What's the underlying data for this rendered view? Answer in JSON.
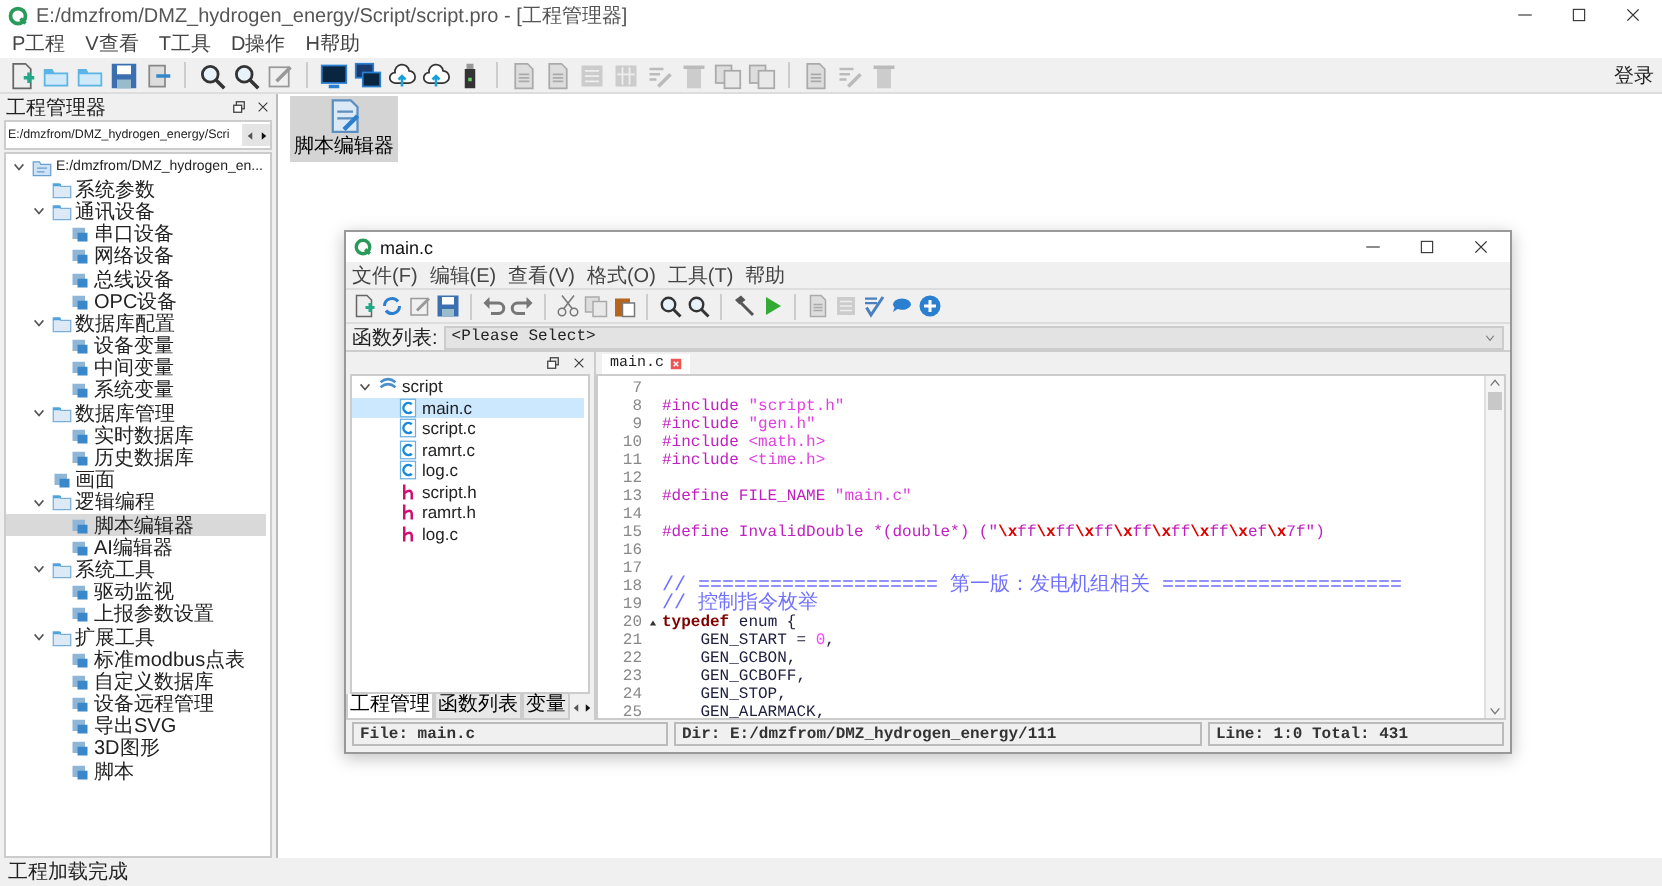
{
  "window": {
    "title": "E:/dmzfrom/DMZ_hydrogen_energy/Script/script.pro - [工程管理器]"
  },
  "menu": [
    "P工程",
    "V查看",
    "T工具",
    "D操作",
    "H帮助"
  ],
  "toolbar": {
    "login": "登录"
  },
  "project_panel": {
    "title": "工程管理器",
    "path": "E:/dmzfrom/DMZ_hydrogen_energy/Scri",
    "tree": [
      {
        "label": "E:/dmzfrom/DMZ_hydrogen_en...",
        "kind": "project",
        "expanded": true,
        "selected": false,
        "children": [
          {
            "label": "系统参数",
            "kind": "folder",
            "selected": false
          },
          {
            "label": "通讯设备",
            "kind": "folder",
            "expanded": true,
            "selected": false,
            "children": [
              {
                "label": "串口设备",
                "kind": "item",
                "selected": false
              },
              {
                "label": "网络设备",
                "kind": "item",
                "selected": false
              },
              {
                "label": "总线设备",
                "kind": "item",
                "selected": false
              },
              {
                "label": "OPC设备",
                "kind": "item",
                "selected": false
              }
            ]
          },
          {
            "label": "数据库配置",
            "kind": "folder",
            "expanded": true,
            "selected": false,
            "children": [
              {
                "label": "设备变量",
                "kind": "item",
                "selected": false
              },
              {
                "label": "中间变量",
                "kind": "item",
                "selected": false
              },
              {
                "label": "系统变量",
                "kind": "item",
                "selected": false
              }
            ]
          },
          {
            "label": "数据库管理",
            "kind": "folder",
            "expanded": true,
            "selected": false,
            "children": [
              {
                "label": "实时数据库",
                "kind": "item",
                "selected": false
              },
              {
                "label": "历史数据库",
                "kind": "item",
                "selected": false
              }
            ]
          },
          {
            "label": "画面",
            "kind": "item",
            "selected": false
          },
          {
            "label": "逻辑编程",
            "kind": "folder",
            "expanded": true,
            "selected": false,
            "children": [
              {
                "label": "脚本编辑器",
                "kind": "item",
                "selected": true
              },
              {
                "label": "AI编辑器",
                "kind": "item",
                "selected": false
              }
            ]
          },
          {
            "label": "系统工具",
            "kind": "folder",
            "expanded": true,
            "selected": false,
            "children": [
              {
                "label": "驱动监视",
                "kind": "item",
                "selected": false
              },
              {
                "label": "上报参数设置",
                "kind": "item",
                "selected": false
              }
            ]
          },
          {
            "label": "扩展工具",
            "kind": "folder",
            "expanded": true,
            "selected": false,
            "children": [
              {
                "label": "标准modbus点表",
                "kind": "item",
                "selected": false
              },
              {
                "label": "自定义数据库",
                "kind": "item",
                "selected": false
              },
              {
                "label": "设备远程管理",
                "kind": "item",
                "selected": false
              },
              {
                "label": "导出SVG",
                "kind": "item",
                "selected": false
              },
              {
                "label": "3D图形",
                "kind": "item",
                "selected": false
              },
              {
                "label": "脚本",
                "kind": "item",
                "selected": false
              }
            ]
          }
        ]
      }
    ]
  },
  "desktop_icons": [
    {
      "label": "脚本编辑器",
      "selected": true
    }
  ],
  "editor_window": {
    "title": "main.c",
    "menu": [
      "文件(F)",
      "编辑(E)",
      "查看(V)",
      "格式(O)",
      "工具(T)",
      "帮助"
    ],
    "function_list": {
      "label": "函数列表:",
      "value": "<Please Select>"
    },
    "file_tree": [
      {
        "label": "script",
        "kind": "project",
        "expanded": true,
        "selected": false,
        "children": [
          {
            "label": "main.c",
            "kind": "c",
            "selected": true
          },
          {
            "label": "script.c",
            "kind": "c",
            "selected": false
          },
          {
            "label": "ramrt.c",
            "kind": "c",
            "selected": false
          },
          {
            "label": "log.c",
            "kind": "c",
            "selected": false
          },
          {
            "label": "script.h",
            "kind": "h",
            "selected": false
          },
          {
            "label": "ramrt.h",
            "kind": "h",
            "selected": false
          },
          {
            "label": "log.c",
            "kind": "h",
            "selected": false
          }
        ]
      }
    ],
    "panel_tabs": [
      {
        "label": "工程管理",
        "selected": true
      },
      {
        "label": "函数列表",
        "selected": false
      },
      {
        "label": "变量",
        "selected": false
      }
    ],
    "tabs": [
      {
        "label": "main.c",
        "selected": true
      }
    ],
    "lines": [
      {
        "number": "7",
        "fold": false
      },
      {
        "number": "8",
        "fold": false,
        "segments": [
          {
            "kind": "preprocessor",
            "text": "#include "
          },
          {
            "kind": "string",
            "text": "\"script.h\""
          }
        ]
      },
      {
        "number": "9",
        "fold": false,
        "segments": [
          {
            "kind": "preprocessor",
            "text": "#include "
          },
          {
            "kind": "string",
            "text": "\"gen.h\""
          }
        ]
      },
      {
        "number": "10",
        "fold": false,
        "segments": [
          {
            "kind": "preprocessor",
            "text": "#include "
          },
          {
            "kind": "string",
            "text": "<math.h>"
          }
        ]
      },
      {
        "number": "11",
        "fold": false,
        "segments": [
          {
            "kind": "preprocessor",
            "text": "#include "
          },
          {
            "kind": "string",
            "text": "<time.h>"
          }
        ]
      },
      {
        "number": "12",
        "fold": false
      },
      {
        "number": "13",
        "fold": false,
        "segments": [
          {
            "kind": "preprocessor",
            "text": "#define FILE_NAME "
          },
          {
            "kind": "string",
            "text": "\"main.c\""
          }
        ]
      },
      {
        "number": "14",
        "fold": false
      },
      {
        "number": "15",
        "fold": false,
        "segments": [
          {
            "kind": "preprocessor",
            "text": "#define InvalidDouble *(double*) (\""
          },
          {
            "kind": "escape",
            "text": "\\x"
          },
          {
            "kind": "preprocessor",
            "text": "ff"
          },
          {
            "kind": "escape",
            "text": "\\x"
          },
          {
            "kind": "preprocessor",
            "text": "ff"
          },
          {
            "kind": "escape",
            "text": "\\x"
          },
          {
            "kind": "preprocessor",
            "text": "ff"
          },
          {
            "kind": "escape",
            "text": "\\x"
          },
          {
            "kind": "preprocessor",
            "text": "ff"
          },
          {
            "kind": "escape",
            "text": "\\x"
          },
          {
            "kind": "preprocessor",
            "text": "ff"
          },
          {
            "kind": "escape",
            "text": "\\x"
          },
          {
            "kind": "preprocessor",
            "text": "ff"
          },
          {
            "kind": "escape",
            "text": "\\x"
          },
          {
            "kind": "preprocessor",
            "text": "ef"
          },
          {
            "kind": "escape",
            "text": "\\x"
          },
          {
            "kind": "preprocessor",
            "text": "7f\")"
          }
        ]
      },
      {
        "number": "16",
        "fold": false
      },
      {
        "number": "17",
        "fold": false
      },
      {
        "number": "18",
        "fold": false,
        "segments": [
          {
            "kind": "comment",
            "text": "// ==================== 第一版：发电机组相关 ===================="
          }
        ]
      },
      {
        "number": "19",
        "fold": false,
        "segments": [
          {
            "kind": "comment",
            "text": "// 控制指令枚举"
          }
        ]
      },
      {
        "number": "20",
        "fold": true,
        "segments": [
          {
            "kind": "keyword",
            "text": "typedef"
          },
          {
            "kind": "plain",
            "text": " enum {"
          }
        ]
      },
      {
        "number": "21",
        "fold": false,
        "segments": [
          {
            "kind": "plain",
            "text": "    GEN_START = "
          },
          {
            "kind": "number",
            "text": "0"
          },
          {
            "kind": "plain",
            "text": ","
          }
        ]
      },
      {
        "number": "22",
        "fold": false,
        "segments": [
          {
            "kind": "plain",
            "text": "    GEN_GCBON,"
          }
        ]
      },
      {
        "number": "23",
        "fold": false,
        "segments": [
          {
            "kind": "plain",
            "text": "    GEN_GCBOFF,"
          }
        ]
      },
      {
        "number": "24",
        "fold": false,
        "segments": [
          {
            "kind": "plain",
            "text": "    GEN_STOP,"
          }
        ]
      },
      {
        "number": "25",
        "fold": false,
        "segments": [
          {
            "kind": "plain",
            "text": "    GEN_ALARMACK,"
          }
        ]
      }
    ],
    "status": {
      "file": "File: main.c",
      "dir": "Dir: E:/dmzfrom/DMZ_hydrogen_energy/111",
      "position": "Line: 1:0 Total: 431"
    }
  },
  "status_bar": "工程加载完成"
}
